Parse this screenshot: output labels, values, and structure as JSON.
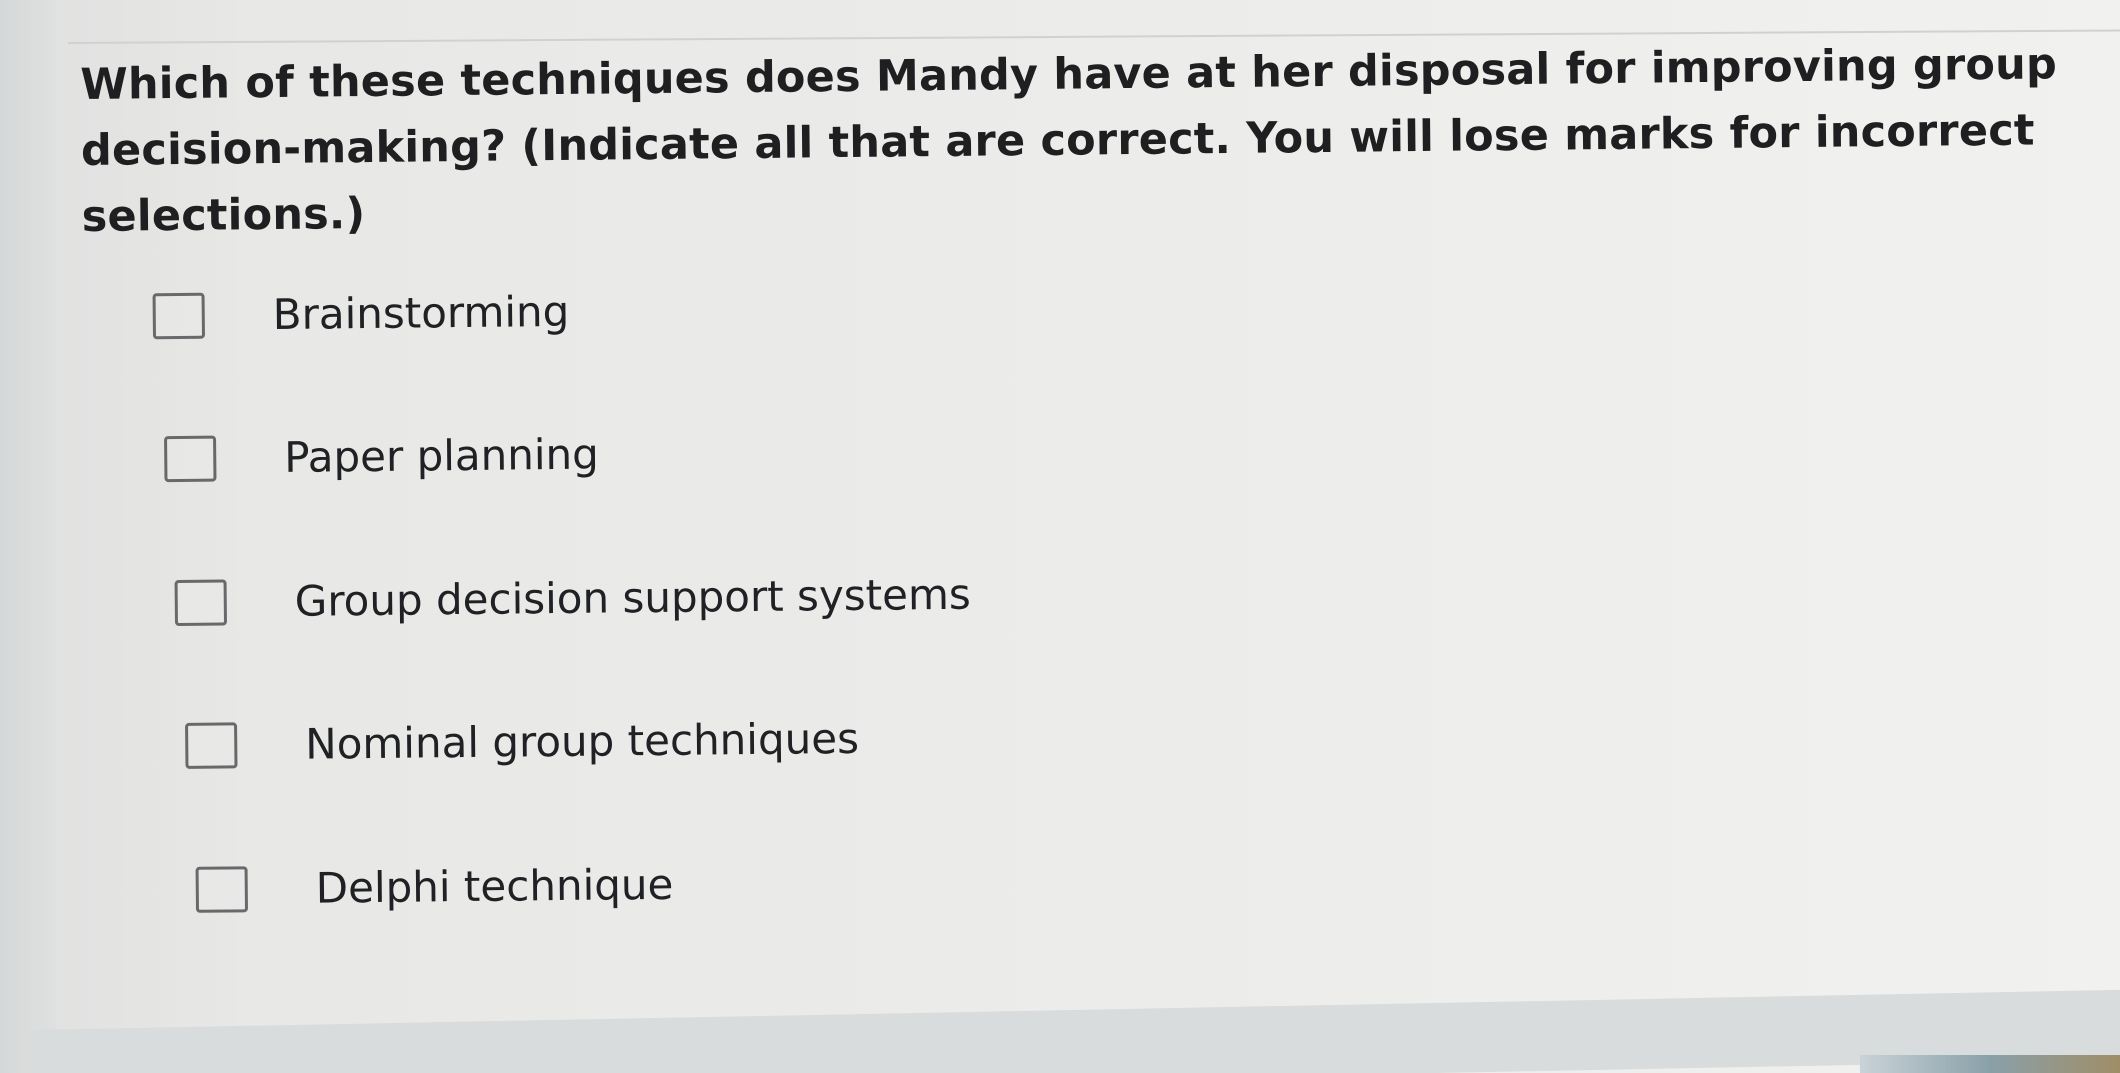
{
  "question": {
    "text": "Which of these techniques does Mandy have at her disposal for improving group decision-making? (Indicate all that are correct. You will lose marks for incorrect selections.)"
  },
  "options": [
    {
      "label": "Brainstorming",
      "checked": false
    },
    {
      "label": "Paper planning",
      "checked": false
    },
    {
      "label": "Group decision support systems",
      "checked": false
    },
    {
      "label": "Nominal group techniques",
      "checked": false
    },
    {
      "label": "Delphi technique",
      "checked": false
    }
  ],
  "colors": {
    "text": "#1f1f21",
    "checkbox_border": "#67696b",
    "background": "#ebebea"
  },
  "icons": {
    "checkbox": "checkbox-empty-icon"
  }
}
